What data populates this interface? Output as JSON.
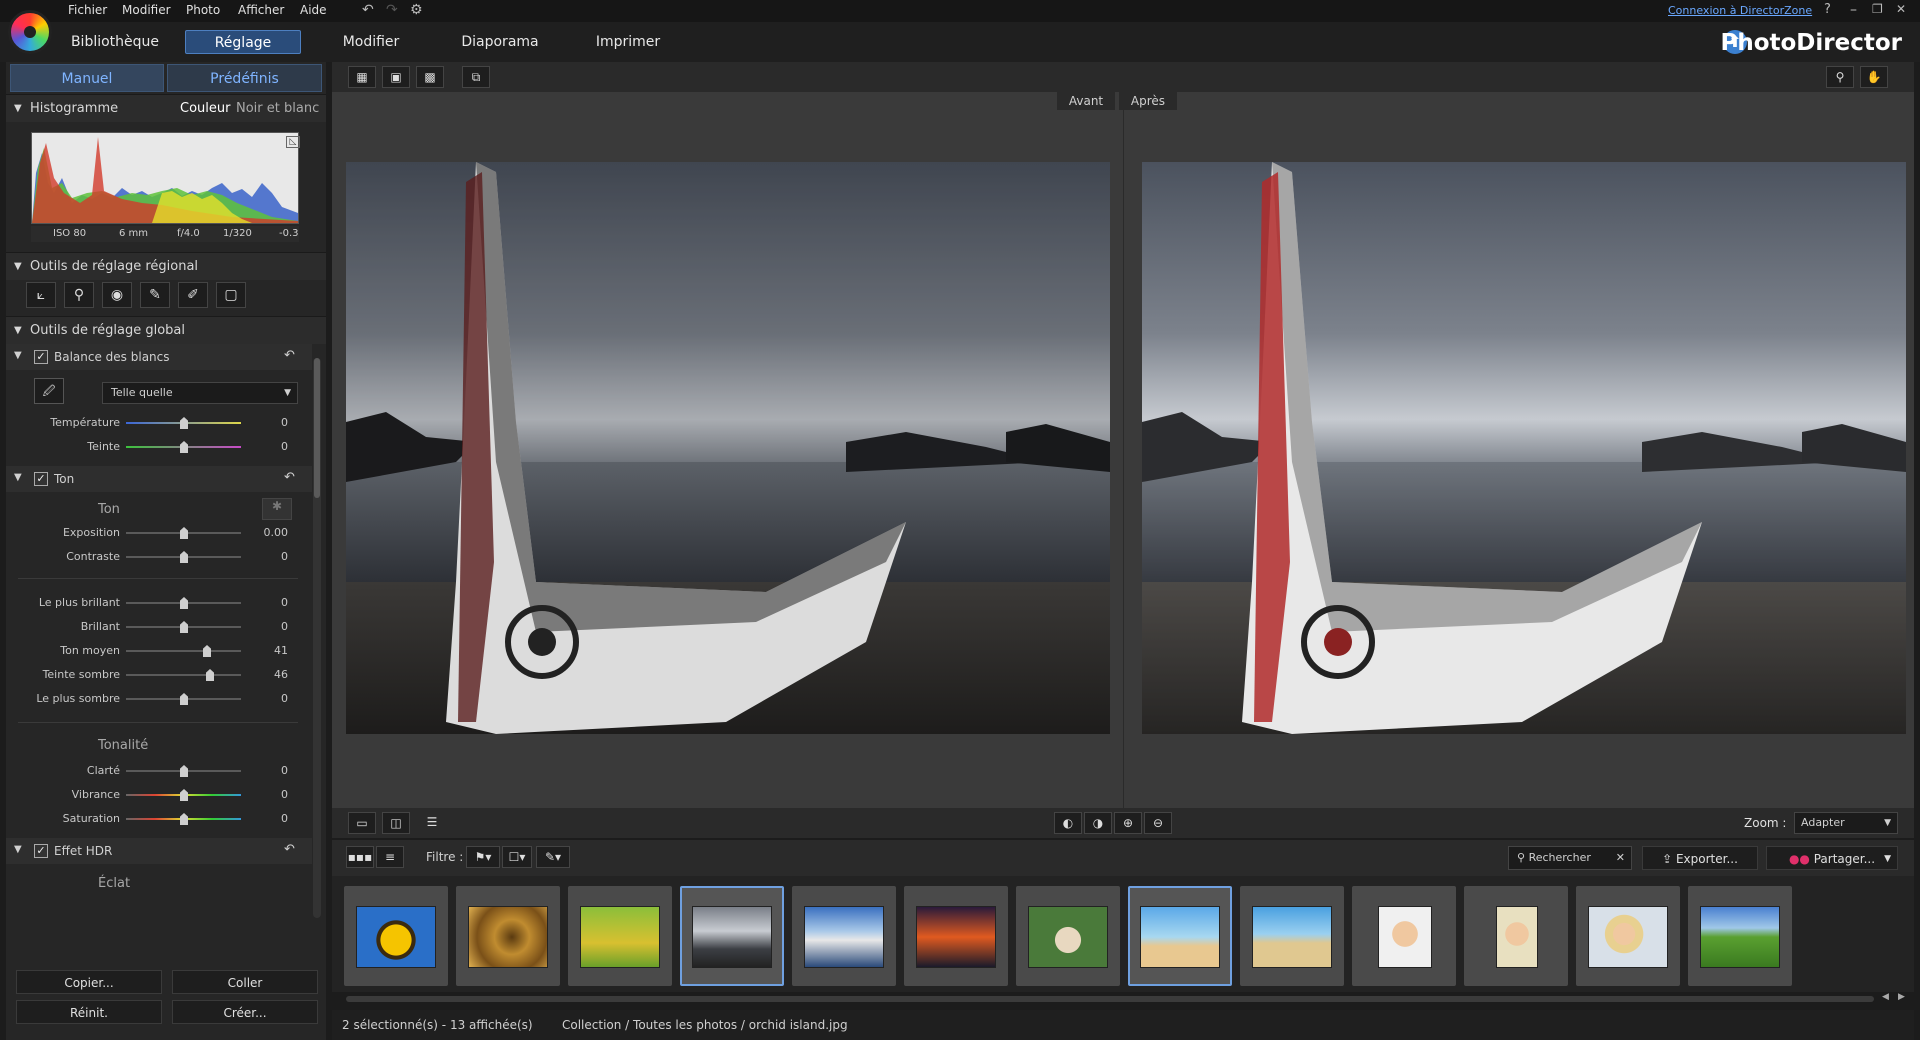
{
  "menu": [
    "Fichier",
    "Modifier",
    "Photo",
    "Afficher",
    "Aide"
  ],
  "window": {
    "login_link": "Connexion à DirectorZone",
    "help": "?",
    "minimize": "–",
    "restore": "❐",
    "close": "✕",
    "brand": "PhotoDirector"
  },
  "main_tabs": [
    "Bibliothèque",
    "Réglage",
    "Modifier",
    "Diaporama",
    "Imprimer"
  ],
  "left": {
    "subtabs": [
      "Manuel",
      "Prédéfinis"
    ],
    "histogram": {
      "title": "Histogramme",
      "mode_color": "Couleur",
      "mode_bw": "Noir et blanc",
      "exif": [
        "ISO 80",
        "6 mm",
        "f/4.0",
        "1/320",
        "-0.3"
      ]
    },
    "regional": {
      "title": "Outils de réglage régional"
    },
    "global": {
      "title": "Outils de réglage global"
    },
    "wb": {
      "title": "Balance des blancs",
      "preset": "Telle quelle",
      "sliders": [
        {
          "label": "Température",
          "value": "0"
        },
        {
          "label": "Teinte",
          "value": "0"
        }
      ]
    },
    "tone": {
      "title": "Ton",
      "sub": "Ton",
      "sliders": [
        {
          "label": "Exposition",
          "value": "0.00"
        },
        {
          "label": "Contraste",
          "value": "0"
        }
      ],
      "sliders2": [
        {
          "label": "Le plus brillant",
          "value": "0"
        },
        {
          "label": "Brillant",
          "value": "0"
        },
        {
          "label": "Ton moyen",
          "value": "41"
        },
        {
          "label": "Teinte sombre",
          "value": "46"
        },
        {
          "label": "Le plus sombre",
          "value": "0"
        }
      ],
      "tonalite": "Tonalité",
      "sliders3": [
        {
          "label": "Clarté",
          "value": "0"
        },
        {
          "label": "Vibrance",
          "value": "0"
        },
        {
          "label": "Saturation",
          "value": "0"
        }
      ]
    },
    "hdr": {
      "title": "Effet HDR",
      "sub": "Éclat"
    },
    "buttons": [
      "Copier...",
      "Coller",
      "Réinit.",
      "Créer..."
    ]
  },
  "viewer": {
    "before": "Avant",
    "after": "Après",
    "zoom_label": "Zoom :",
    "zoom_value": "Adapter"
  },
  "film": {
    "filter_label": "Filtre :",
    "search": "Rechercher",
    "export": "Exporter...",
    "share": "Partager..."
  },
  "status": {
    "selection": "2 sélectionné(s) - 13 affichée(s)",
    "path": "Collection / Toutes les photos / orchid island.jpg"
  },
  "thumbs": [
    "sunflower",
    "spiral",
    "bicycle",
    "boat",
    "lake",
    "sunset",
    "cat",
    "beach-couple",
    "beach-walk",
    "woman-smile",
    "woman-laugh",
    "woman-portrait",
    "meadow"
  ]
}
